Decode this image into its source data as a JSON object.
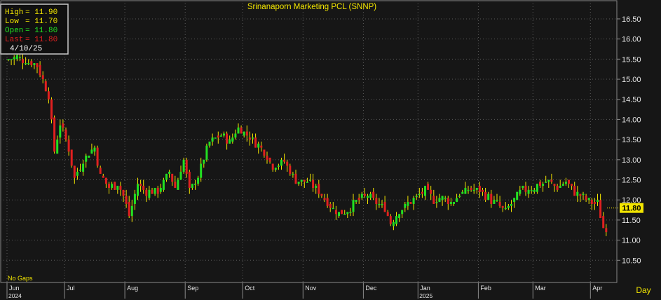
{
  "chart_data": {
    "type": "ohlc",
    "title": "Srinanaporn  Marketing  PCL  (SNNP)",
    "period": "Day",
    "gaps_label": "No Gaps",
    "y_ticks": [
      10.5,
      11.0,
      11.5,
      12.0,
      12.5,
      13.0,
      13.5,
      14.0,
      14.5,
      15.0,
      15.5,
      16.0,
      16.5
    ],
    "y_tick_labels": [
      "10.50",
      "11.00",
      "11.50",
      "12.00",
      "12.50",
      "13.00",
      "13.50",
      "14.00",
      "14.50",
      "15.00",
      "15.50",
      "16.00",
      "16.50"
    ],
    "ylim": [
      10.0,
      16.9
    ],
    "months": [
      {
        "label": "Jun",
        "index": 0
      },
      {
        "label": "Jul",
        "index": 20
      },
      {
        "label": "Aug",
        "index": 41
      },
      {
        "label": "Sep",
        "index": 62
      },
      {
        "label": "Oct",
        "index": 82
      },
      {
        "label": "Nov",
        "index": 103
      },
      {
        "label": "Dec",
        "index": 124
      },
      {
        "label": "Jan",
        "index": 143
      },
      {
        "label": "Feb",
        "index": 164
      },
      {
        "label": "Mar",
        "index": 183
      },
      {
        "label": "Apr",
        "index": 203
      }
    ],
    "years": [
      {
        "label": "2024",
        "index": 0
      },
      {
        "label": "2025",
        "index": 143
      }
    ],
    "colors": {
      "up": "#22e022",
      "down": "#e02020",
      "wick": "#f2e500",
      "grid": "#5a5a5a"
    },
    "last_value": "11.80",
    "info_box": {
      "high_label": "High",
      "high_value": "= 11.90",
      "low_label": "Low",
      "low_value": "= 11.70",
      "open_label": "Open",
      "open_value": "= 11.80",
      "last_label": "Last",
      "last_value": "= 11.80",
      "date": "4/10/25"
    },
    "anchors": [
      [
        0,
        15.5
      ],
      [
        3,
        15.55
      ],
      [
        10,
        15.35
      ],
      [
        14,
        14.6
      ],
      [
        16,
        13.2
      ],
      [
        18,
        13.9
      ],
      [
        21,
        13.25
      ],
      [
        23,
        12.55
      ],
      [
        26,
        13.0
      ],
      [
        30,
        13.3
      ],
      [
        32,
        12.6
      ],
      [
        35,
        12.3
      ],
      [
        38,
        12.4
      ],
      [
        40,
        12.1
      ],
      [
        42,
        11.6
      ],
      [
        45,
        12.4
      ],
      [
        48,
        12.2
      ],
      [
        52,
        12.2
      ],
      [
        56,
        12.7
      ],
      [
        58,
        12.3
      ],
      [
        61,
        13.0
      ],
      [
        63,
        12.2
      ],
      [
        66,
        12.6
      ],
      [
        70,
        13.45
      ],
      [
        74,
        13.6
      ],
      [
        77,
        13.45
      ],
      [
        80,
        13.8
      ],
      [
        84,
        13.55
      ],
      [
        88,
        13.3
      ],
      [
        92,
        12.85
      ],
      [
        96,
        12.95
      ],
      [
        100,
        12.5
      ],
      [
        104,
        12.45
      ],
      [
        108,
        12.2
      ],
      [
        112,
        11.85
      ],
      [
        115,
        11.65
      ],
      [
        118,
        11.75
      ],
      [
        121,
        11.95
      ],
      [
        125,
        12.1
      ],
      [
        128,
        11.95
      ],
      [
        131,
        11.8
      ],
      [
        133,
        11.45
      ],
      [
        136,
        11.75
      ],
      [
        139,
        11.9
      ],
      [
        142,
        12.05
      ],
      [
        145,
        12.25
      ],
      [
        148,
        12.0
      ],
      [
        151,
        12.05
      ],
      [
        154,
        11.95
      ],
      [
        157,
        12.15
      ],
      [
        160,
        12.25
      ],
      [
        164,
        12.25
      ],
      [
        167,
        12.05
      ],
      [
        170,
        11.9
      ],
      [
        173,
        11.7
      ],
      [
        176,
        12.0
      ],
      [
        179,
        12.25
      ],
      [
        182,
        12.3
      ],
      [
        185,
        12.4
      ],
      [
        188,
        12.45
      ],
      [
        191,
        12.3
      ],
      [
        194,
        12.45
      ],
      [
        197,
        12.2
      ],
      [
        200,
        12.05
      ],
      [
        203,
        11.95
      ],
      [
        205,
        11.9
      ],
      [
        207,
        11.3
      ],
      [
        208,
        11.3
      ]
    ]
  }
}
